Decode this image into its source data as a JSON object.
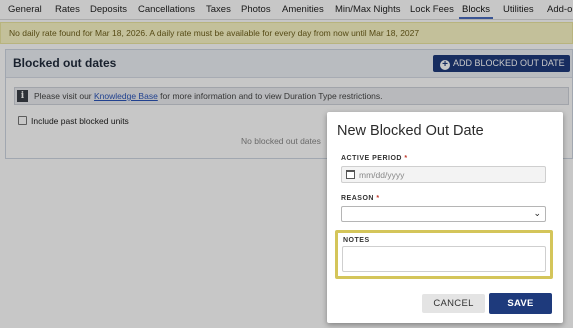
{
  "tabs": {
    "items": [
      {
        "label": "General"
      },
      {
        "label": "Rates"
      },
      {
        "label": "Deposits"
      },
      {
        "label": "Cancellations"
      },
      {
        "label": "Taxes"
      },
      {
        "label": "Photos"
      },
      {
        "label": "Amenities"
      },
      {
        "label": "Min/Max Nights"
      },
      {
        "label": "Lock Fees"
      },
      {
        "label": "Blocks"
      },
      {
        "label": "Utilities"
      },
      {
        "label": "Add-o"
      }
    ],
    "active": "Blocks"
  },
  "notice": {
    "text": "No daily rate found for Mar 18, 2026. A daily rate must be available for every day from now until Mar 18, 2027"
  },
  "section": {
    "title": "Blocked out dates",
    "add_button": "ADD BLOCKED OUT DATE",
    "info": {
      "prefix": "Please visit our ",
      "link": "Knowledge Base",
      "suffix": " for more information and to view Duration Type restrictions."
    },
    "include_past_label": "Include past blocked units",
    "empty_text": "No blocked out dates"
  },
  "modal": {
    "title": "New Blocked Out Date",
    "active_period_label": "ACTIVE PERIOD",
    "required_mark": "*",
    "date_placeholder": "mm/dd/yyyy",
    "reason_label": "REASON",
    "reason_value": "",
    "notes_label": "NOTES",
    "notes_value": "",
    "cancel_label": "CANCEL",
    "save_label": "SAVE"
  },
  "colors": {
    "primary": "#1e3a7c",
    "notice_bg": "#faf7c6",
    "highlight": "#d4c55a",
    "required": "#c0392b"
  }
}
